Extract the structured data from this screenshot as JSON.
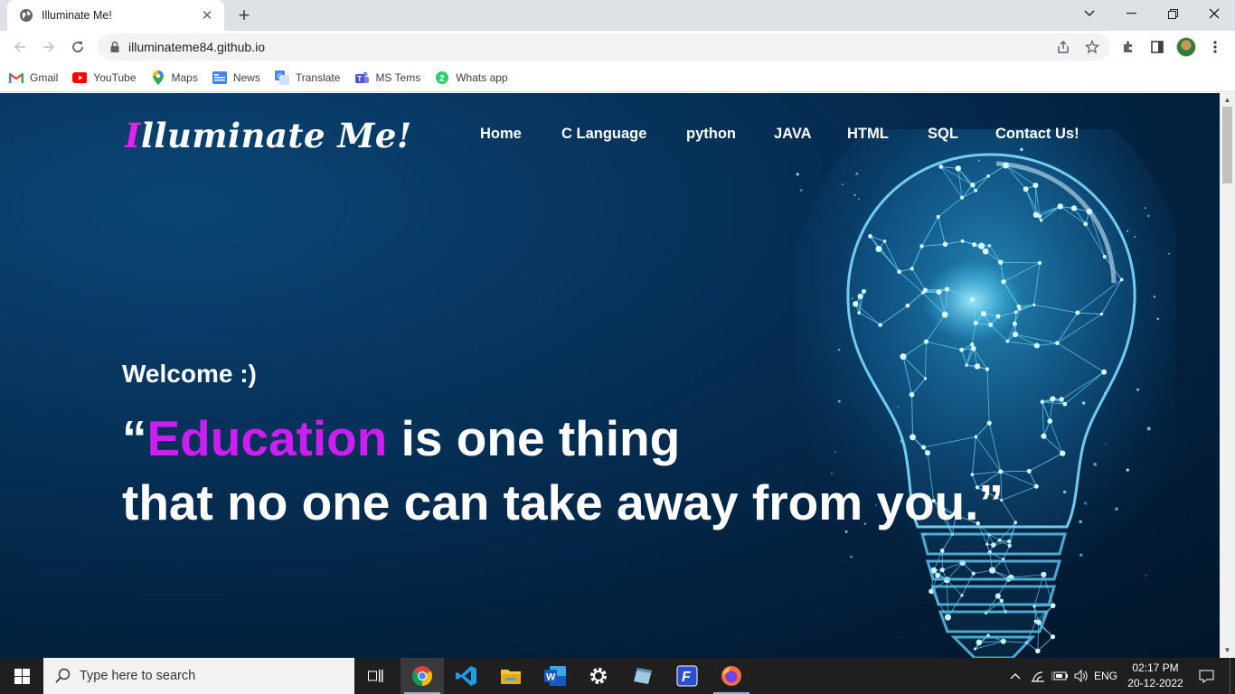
{
  "browser": {
    "tab_title": "Illuminate Me!",
    "url": "illuminateme84.github.io",
    "bookmarks": [
      {
        "label": "Gmail",
        "icon": "gmail-icon"
      },
      {
        "label": "YouTube",
        "icon": "youtube-icon"
      },
      {
        "label": "Maps",
        "icon": "maps-icon"
      },
      {
        "label": "News",
        "icon": "news-icon"
      },
      {
        "label": "Translate",
        "icon": "translate-icon"
      },
      {
        "label": "MS Tems",
        "icon": "teams-icon"
      },
      {
        "label": "Whats app",
        "icon": "whatsapp-icon",
        "badge": "2"
      }
    ]
  },
  "site": {
    "logo_first": "I",
    "logo_rest": "lluminate Me!",
    "nav": [
      "Home",
      "C Language",
      "python",
      "JAVA",
      "HTML",
      "SQL",
      "Contact Us!"
    ],
    "welcome": "Welcome :)",
    "quote_open": "“",
    "quote_highlight": "Education",
    "quote_line1_rest": " is one thing",
    "quote_line2": "that no one can take away from you.”",
    "colors": {
      "accent": "#cc1ef0",
      "logo_accent": "#e91ef0",
      "background": "#03203d"
    }
  },
  "taskbar": {
    "search_placeholder": "Type here to search",
    "language": "ENG",
    "time": "02:17 PM",
    "date": "20-12-2022",
    "apps": [
      "task-view",
      "chrome",
      "vscode",
      "file-explorer",
      "word",
      "settings",
      "notepad",
      "fontforge",
      "firefox"
    ]
  }
}
